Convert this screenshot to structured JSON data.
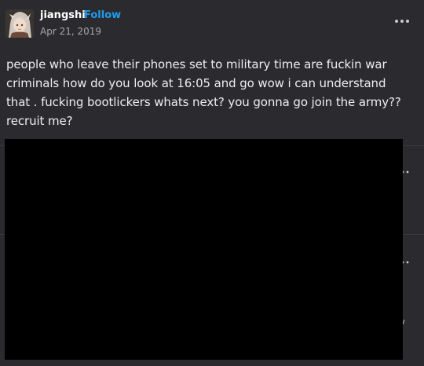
{
  "post": {
    "blog_name": "jiangshi",
    "follow_label": "Follow",
    "date": "Apr 21, 2019",
    "body": "people who leave their phones set to military time are fuckin war criminals how do you look at 16:05 and go wow i can understand that . fucking bootlickers whats next? you gonna go join the army??recruit me?"
  },
  "icons": {
    "more": "more-options-icon",
    "avatar": "avatar-image"
  },
  "colors": {
    "background": "#2b2b2f",
    "follow_link": "#1e9cf0",
    "redaction": "#000000"
  }
}
